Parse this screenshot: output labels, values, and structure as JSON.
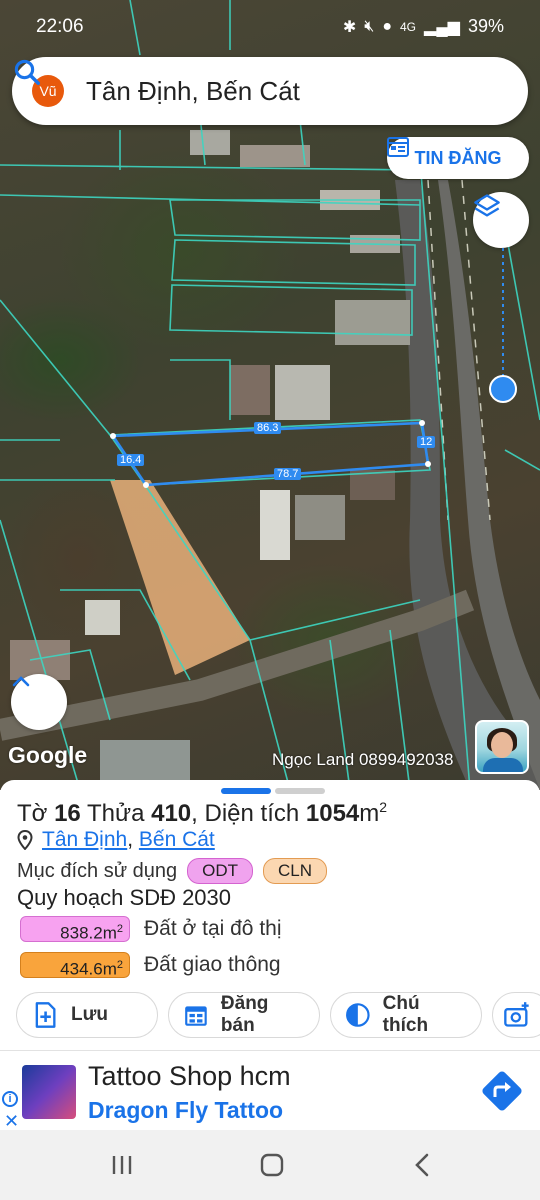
{
  "status_bar": {
    "time": "22:06",
    "network": "4G",
    "battery": "39%"
  },
  "search": {
    "avatar": "Vũ",
    "title": "Tân Định, Bến Cát"
  },
  "tin_dang": {
    "label": "TIN ĐĂNG"
  },
  "map": {
    "google_logo": "Google",
    "watermark": "Ngọc Land 0899492038",
    "measurements": [
      "86.3",
      "12",
      "16.4",
      "78.7"
    ]
  },
  "sheet": {
    "sheet_prefix": "Tờ",
    "sheet_no": "16",
    "parcel_prefix": "Thửa",
    "parcel_no": "410",
    "area_prefix": ", Diện tích",
    "area_value": "1054",
    "area_unit": "m",
    "area_sup": "2",
    "ward": "Tân Định",
    "district": "Bến Cát",
    "purpose_label": "Mục đích sử dụng",
    "purpose_tags": [
      "ODT",
      "CLN"
    ],
    "plan_label": "Quy hoạch SDĐ 2030",
    "areas": [
      {
        "value": "838.2m",
        "sup": "2",
        "label": "Đất ở tại đô thị",
        "color": "#f7a2f0"
      },
      {
        "value": "434.6m",
        "sup": "2",
        "label": "Đất giao thông",
        "color": "#f9a43c"
      }
    ],
    "actions": {
      "save": "Lưu",
      "sell": "Đăng bán",
      "legend": "Chú thích"
    }
  },
  "ad": {
    "title": "Tattoo Shop hcm",
    "subtitle": "Dragon Fly Tattoo"
  },
  "colors": {
    "accent": "#1a73e8",
    "parcel_outline": "#3dd6c2",
    "measure_line": "#2f8bf0",
    "highlight_lot": "#e8b07a"
  }
}
